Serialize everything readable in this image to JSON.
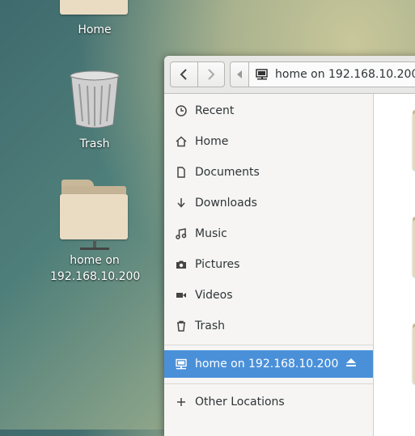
{
  "desktop": {
    "icons": [
      {
        "label": "Home"
      },
      {
        "label": "Trash"
      },
      {
        "label": "home on 192.168.10.200"
      }
    ]
  },
  "window": {
    "path": {
      "current": "home on 192.168.10.200"
    },
    "sidebar": {
      "items": [
        {
          "label": "Recent",
          "icon": "clock-icon"
        },
        {
          "label": "Home",
          "icon": "home-icon"
        },
        {
          "label": "Documents",
          "icon": "document-icon"
        },
        {
          "label": "Downloads",
          "icon": "download-icon"
        },
        {
          "label": "Music",
          "icon": "music-icon"
        },
        {
          "label": "Pictures",
          "icon": "camera-icon"
        },
        {
          "label": "Videos",
          "icon": "video-icon"
        },
        {
          "label": "Trash",
          "icon": "trash-icon"
        }
      ],
      "mount": {
        "label": "home on 192.168.10.200",
        "icon": "network-drive-icon",
        "selected": true
      },
      "other": {
        "label": "Other Locations",
        "icon": "plus-icon"
      }
    },
    "colors": {
      "selection": "#4a90d9"
    }
  }
}
